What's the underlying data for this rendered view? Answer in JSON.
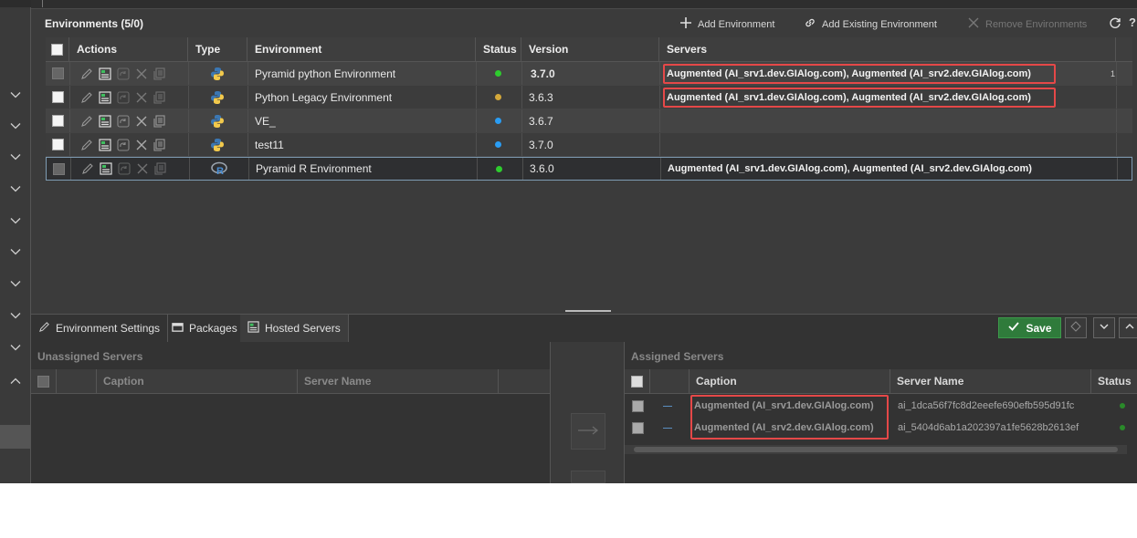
{
  "header": {
    "title": "Environments (5/0)",
    "add_environment": "Add Environment",
    "add_existing_environment": "Add Existing Environment",
    "remove_environments": "Remove Environments",
    "help": "?"
  },
  "grid": {
    "columns": [
      "Actions",
      "Type",
      "Environment",
      "Status",
      "Version",
      "Servers"
    ],
    "rows": [
      {
        "type": "python",
        "environment": "Pyramid python Environment",
        "status_color": "#2ecc2e",
        "version": "3.7.0",
        "servers": "Augmented (AI_srv1.dev.GIAlog.com), Augmented (AI_srv2.dev.GIAlog.com)",
        "extra": "1"
      },
      {
        "type": "python",
        "environment": "Python Legacy Environment",
        "status_color": "#d4a83a",
        "version": "3.6.3",
        "servers": "Augmented (AI_srv1.dev.GIAlog.com), Augmented (AI_srv2.dev.GIAlog.com)",
        "extra": ""
      },
      {
        "type": "python",
        "environment": "VE_",
        "status_color": "#2a9df4",
        "version": "3.6.7",
        "servers": "",
        "extra": ""
      },
      {
        "type": "python",
        "environment": "test11",
        "status_color": "#2a9df4",
        "version": "3.7.0",
        "servers": "",
        "extra": ""
      },
      {
        "type": "r",
        "environment": "Pyramid R Environment",
        "status_color": "#2ecc2e",
        "version": "3.6.0",
        "servers": "Augmented (AI_srv1.dev.GIAlog.com), Augmented (AI_srv2.dev.GIAlog.com)",
        "extra": ""
      }
    ]
  },
  "tabs": {
    "environment_settings": "Environment Settings",
    "packages": "Packages",
    "hosted_servers": "Hosted Servers",
    "save": "Save"
  },
  "unassigned": {
    "title": "Unassigned Servers",
    "col_caption": "Caption",
    "col_server_name": "Server Name"
  },
  "assigned": {
    "title": "Assigned Servers",
    "col_caption": "Caption",
    "col_server_name": "Server Name",
    "col_status": "Status",
    "rows": [
      {
        "caption": "Augmented (AI_srv1.dev.GIAlog.com)",
        "server_name": "ai_1dca56f7fc8d2eeefe690efb595d91fc"
      },
      {
        "caption": "Augmented (AI_srv2.dev.GIAlog.com)",
        "server_name": "ai_5404d6ab1a202397a1fe5628b2613ef"
      }
    ]
  },
  "colors": {
    "accent_red": "#e54848",
    "save_green": "#2f7b3b",
    "status_green": "#2ecc2e"
  },
  "icons": [
    "plus-icon",
    "link-icon",
    "close-icon",
    "refresh-icon",
    "pencil-icon",
    "hosted-servers-icon",
    "packages-icon",
    "check-icon",
    "chevron-down-icon",
    "chevron-up-icon",
    "python-icon",
    "r-icon"
  ]
}
